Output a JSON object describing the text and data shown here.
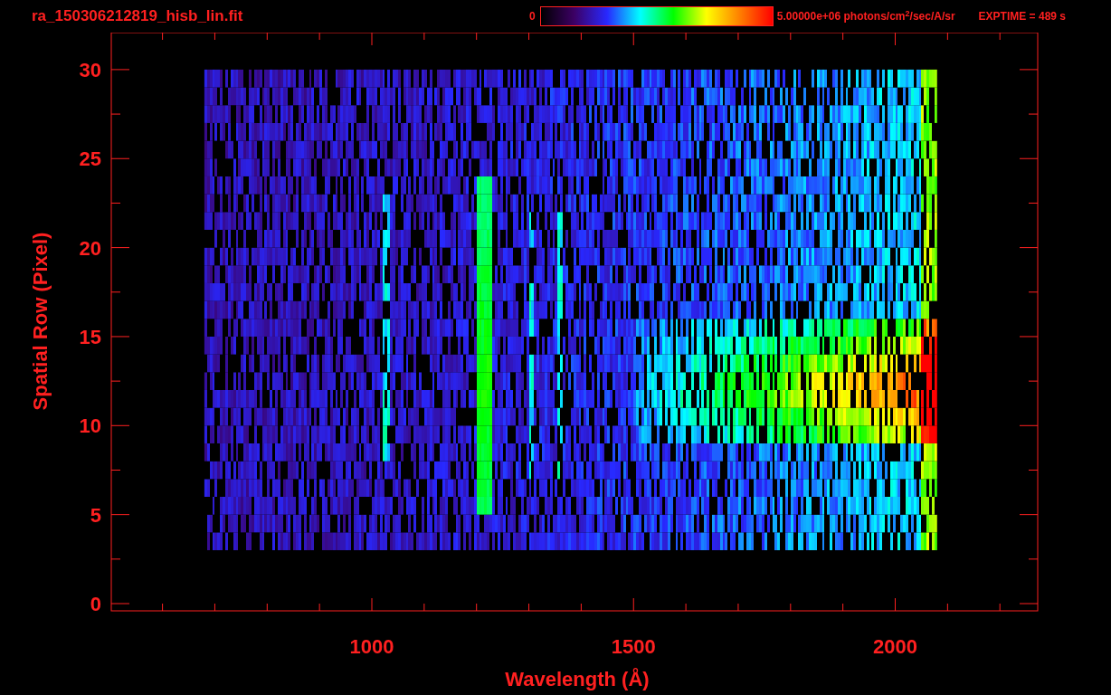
{
  "header": {
    "title": "ra_150306212819_hisb_lin.fit",
    "colorbar_min": "0",
    "colorbar_max": "5.00000e+06 photons/cm$^{2}$/sec/A/sr",
    "exposure": "EXPTIME = 489 s"
  },
  "plot": {
    "xlabel": "Wavelength (Å)",
    "ylabel": "Spatial Row (Pixel)",
    "xticks": [
      "1000",
      "1500",
      "2000"
    ],
    "yticks": [
      "30",
      "25",
      "20",
      "15",
      "10",
      "5",
      "0"
    ]
  }
}
